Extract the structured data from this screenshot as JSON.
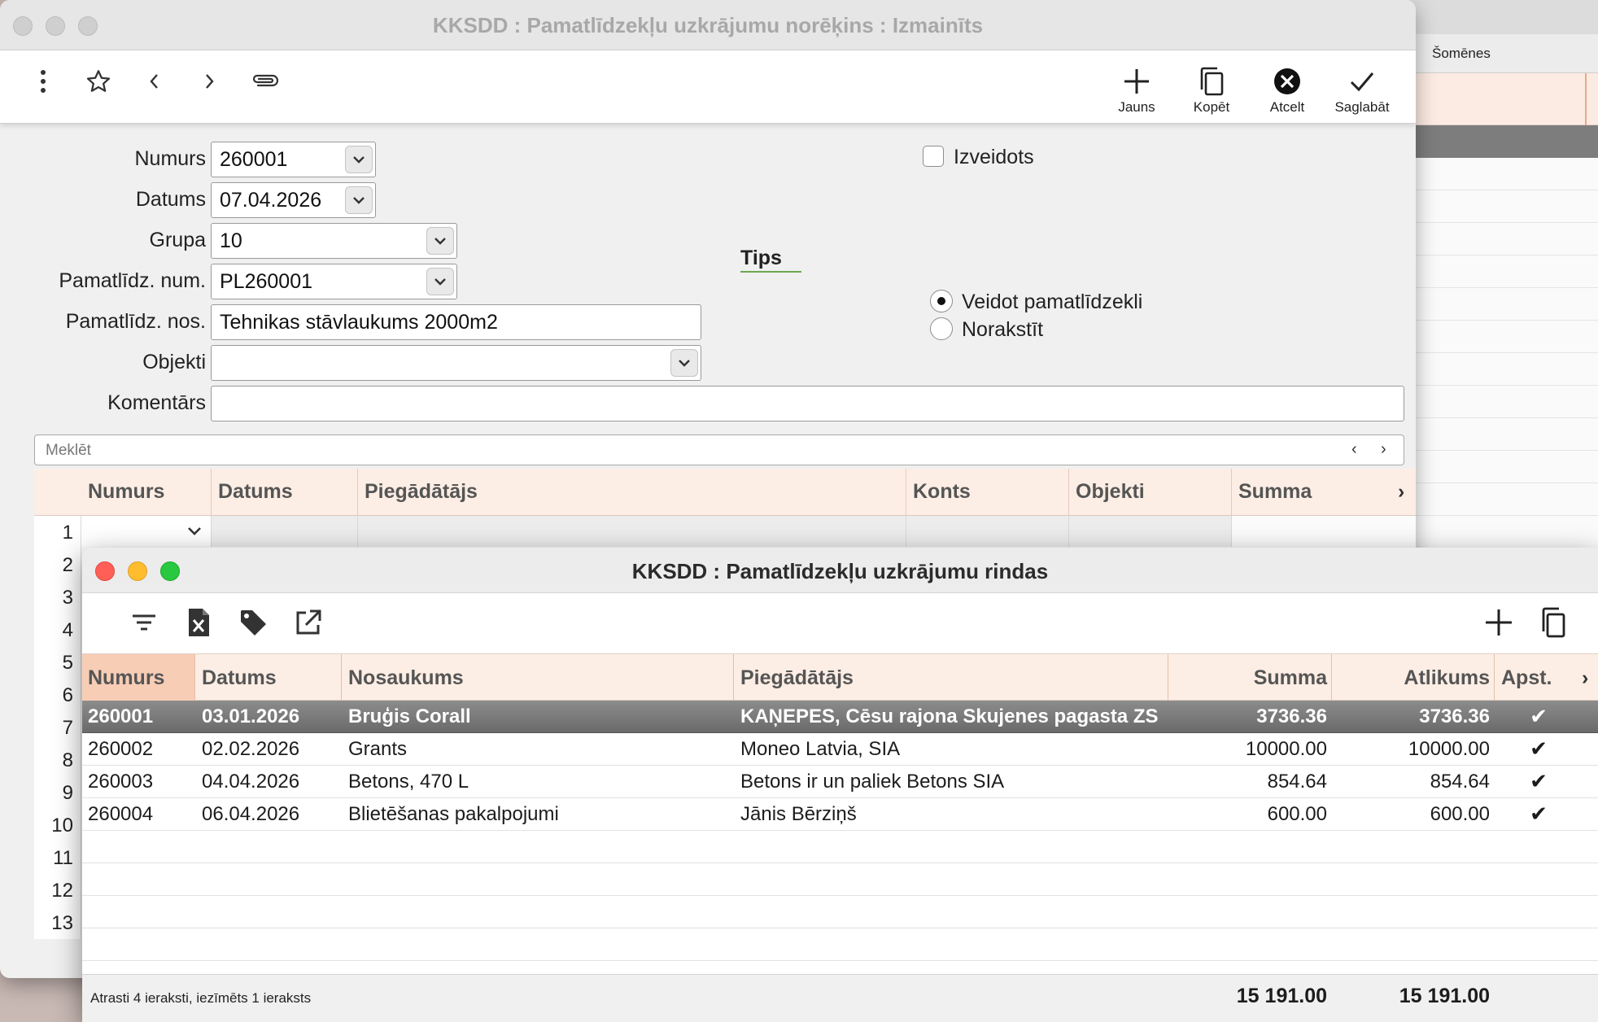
{
  "background_window": {
    "tab_label": "Šomēnes"
  },
  "main_window": {
    "title": "KKSDD : Pamatlīdzekļu uzkrājumu norēķins : Izmainīts",
    "toolbar": {
      "left_icons": [
        "more-icon",
        "star-icon",
        "chevron-left-icon",
        "chevron-right-icon",
        "paperclip-icon"
      ],
      "actions": [
        {
          "label": "Jauns",
          "icon": "plus-icon"
        },
        {
          "label": "Kopēt",
          "icon": "copy-icon"
        },
        {
          "label": "Atcelt",
          "icon": "cancel-icon"
        },
        {
          "label": "Saglabāt",
          "icon": "checkmark-icon"
        }
      ]
    },
    "form": {
      "numurs": {
        "label": "Numurs",
        "value": "260001"
      },
      "datums": {
        "label": "Datums",
        "value": "07.04.2026"
      },
      "grupa": {
        "label": "Grupa",
        "value": "10"
      },
      "pamatlidz_num": {
        "label": "Pamatlīdz. num.",
        "value": "PL260001"
      },
      "pamatlidz_nos": {
        "label": "Pamatlīdz. nos.",
        "value": "Tehnikas stāvlaukums 2000m2"
      },
      "objekti": {
        "label": "Objekti",
        "value": ""
      },
      "komentars": {
        "label": "Komentārs",
        "value": ""
      },
      "izveidots": {
        "label": "Izveidots",
        "checked": false
      },
      "tips": {
        "label": "Tips",
        "options": [
          {
            "label": "Veidot pamatlīdzekli",
            "selected": true
          },
          {
            "label": "Norakstīt",
            "selected": false
          }
        ]
      }
    },
    "search": {
      "placeholder": "Meklēt"
    },
    "grid": {
      "columns": [
        "Numurs",
        "Datums",
        "Piegādātājs",
        "Konts",
        "Objekti",
        "Summa"
      ],
      "row_numbers": [
        "1",
        "2",
        "3",
        "4",
        "5",
        "6",
        "7",
        "8",
        "9",
        "10",
        "11",
        "12",
        "13"
      ]
    }
  },
  "front_window": {
    "title": "KKSDD : Pamatlīdzekļu uzkrājumu rindas",
    "toolbar": {
      "left_icons": [
        "filter-icon",
        "excel-file-icon",
        "tag-icon",
        "external-link-icon"
      ],
      "right_icons": [
        "plus-icon",
        "copy-icon"
      ]
    },
    "columns": [
      "Numurs",
      "Datums",
      "Nosaukums",
      "Piegādātājs",
      "Summa",
      "Atlikums",
      "Apst."
    ],
    "rows": [
      {
        "numurs": "260001",
        "datums": "03.01.2026",
        "nosaukums": "Bruģis Corall",
        "piegadatajs": "KAŅEPES, Cēsu rajona Skujenes pagasta ZS",
        "summa": "3736.36",
        "atlikums": "3736.36",
        "apst": "✔",
        "selected": true
      },
      {
        "numurs": "260002",
        "datums": "02.02.2026",
        "nosaukums": "Grants",
        "piegadatajs": "Moneo Latvia, SIA",
        "summa": "10000.00",
        "atlikums": "10000.00",
        "apst": "✔",
        "selected": false
      },
      {
        "numurs": "260003",
        "datums": "04.04.2026",
        "nosaukums": "Betons, 470 L",
        "piegadatajs": "Betons ir un paliek Betons SIA",
        "summa": "854.64",
        "atlikums": "854.64",
        "apst": "✔",
        "selected": false
      },
      {
        "numurs": "260004",
        "datums": "06.04.2026",
        "nosaukums": "Blietēšanas pakalpojumi",
        "piegadatajs": "Jānis Bērziņš",
        "summa": "600.00",
        "atlikums": "600.00",
        "apst": "✔",
        "selected": false
      }
    ],
    "footer": {
      "status": "Atrasti 4 ieraksti, iezīmēts 1 ieraksts",
      "total_summa": "15 191.00",
      "total_atlikums": "15 191.00"
    }
  }
}
